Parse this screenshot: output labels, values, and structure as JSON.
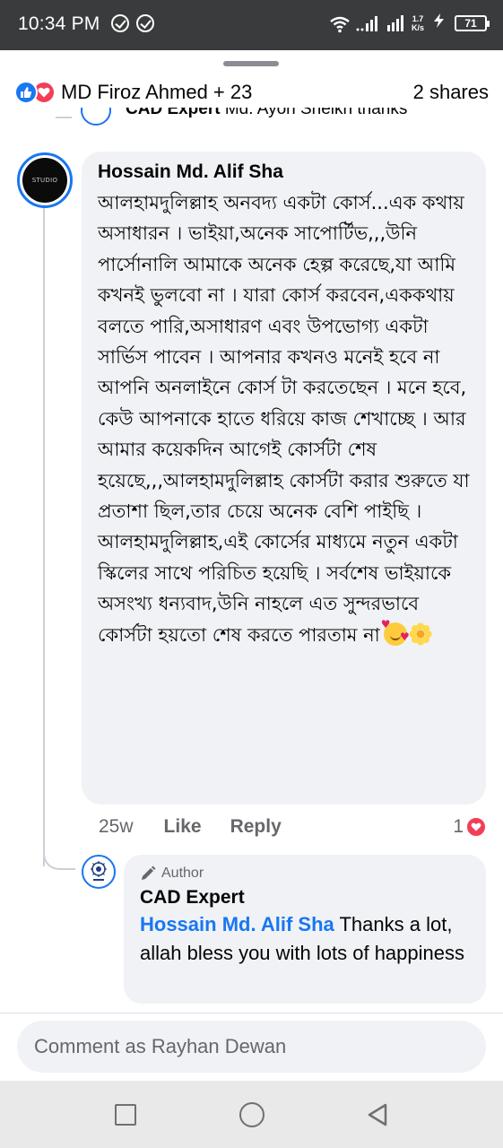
{
  "status_bar": {
    "time": "10:34 PM",
    "net_speed_value": "1.7",
    "net_speed_unit": "K/s",
    "battery": "71",
    "icons": [
      "check-circle-icon",
      "check-circle-icon",
      "wifi-icon",
      "signal-icon",
      "signal-icon",
      "charging-icon",
      "battery-icon"
    ]
  },
  "header": {
    "reactions": [
      "like-icon",
      "love-icon"
    ],
    "reactors": "MD Firoz Ahmed + 23",
    "shares": "2 shares"
  },
  "previous_comment": {
    "author": "CAD Expert",
    "text": "Md. Ayon Sheikh thanks"
  },
  "comment": {
    "author": "Hossain Md. Alif Sha",
    "avatar_text": "STUDIO",
    "body": "আলহামদুলিল্লাহ অনবদ্য একটা কোর্স...এক কথায় অসাধারন । ভাইয়া,অনেক সাপোর্টিভ,,,উনি পার্সোনালি আমাকে অনেক হেল্প করেছে,যা আমি কখনই ভুলবো না । যারা কোর্স করবেন,এককথায় বলতে পারি,অসাধারণ এবং উপভোগ্য একটা সার্ভিস পাবেন । আপনার কখনও মনেই হবে না আপনি অনলাইনে কোর্স টা করতেছেন । মনে হবে, কেউ আপনাকে হাতে ধরিয়ে কাজ শেখাচ্ছে । আর আমার কয়েকদিন আগেই কোর্সটা শেষ হয়েছে,,,আলহামদুলিল্লাহ কোর্সটা করার শুরুতে যা প্রতাশা ছিল,তার চেয়ে অনেক বেশি পাইছি । আলহামদুলিল্লাহ,এই কোর্সের মাধ্যমে নতুন একটা স্কিলের সাথে পরিচিত হয়েছি । সর্বশেষ ভাইয়াকে অসংখ্য ধন্যবাদ,উনি নাহলে এত সুন্দরভাবে কোর্সটা হয়তো শেষ করতে পারতাম না",
    "emojis": [
      "smiling-face-with-hearts-icon",
      "blossom-icon"
    ],
    "time": "25w",
    "like_label": "Like",
    "reply_label": "Reply",
    "reaction_count": "1",
    "reaction_icon": "love-icon"
  },
  "reply": {
    "badge_icon": "pencil-icon",
    "badge": "Author",
    "author": "CAD Expert",
    "mention": "Hossain Md. Alif Sha",
    "text": " Thanks a lot, allah bless you with lots of happiness"
  },
  "composer": {
    "placeholder": "Comment as Rayhan Dewan"
  },
  "nav": {
    "buttons": [
      "recent-apps-icon",
      "home-icon",
      "back-icon"
    ]
  },
  "colors": {
    "accent": "#1877f2",
    "love": "#f33e58",
    "bubble": "#f0f2f5",
    "status_bar": "#3a3b3c"
  }
}
